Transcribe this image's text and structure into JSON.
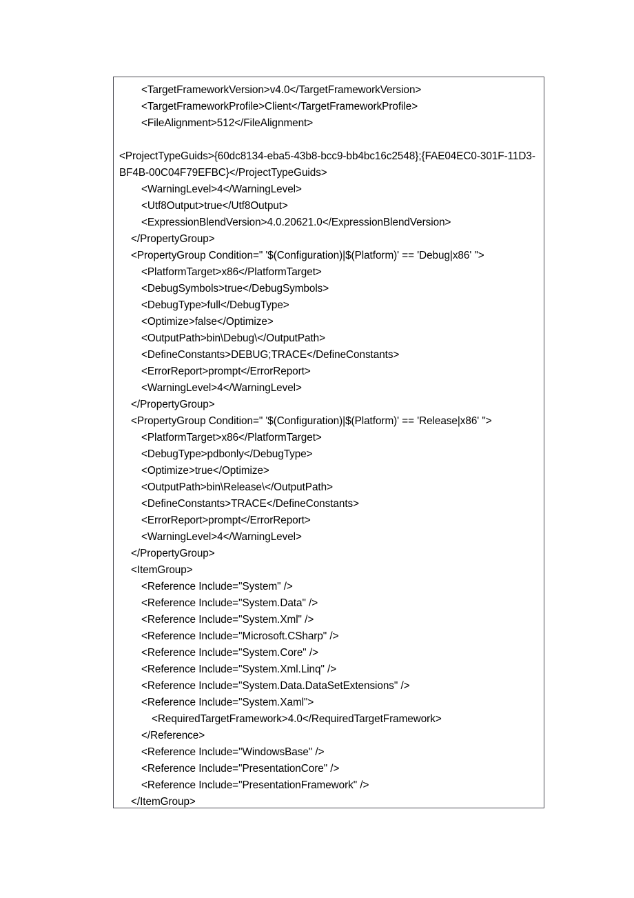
{
  "document": {
    "type": "xml-code-listing",
    "language": "MSBuild XML project file",
    "frame": {
      "border_color": "#4a4a52",
      "background_color": "#ffffff",
      "text_color": "#000000"
    },
    "lines": [
      {
        "id": "line-1",
        "indent": 2,
        "text": "<TargetFrameworkVersion>v4.0</TargetFrameworkVersion>"
      },
      {
        "id": "line-2",
        "indent": 2,
        "text": "<TargetFrameworkProfile>Client</TargetFrameworkProfile>"
      },
      {
        "id": "line-3",
        "indent": 2,
        "text": "<FileAlignment>512</FileAlignment>"
      },
      {
        "id": "line-4",
        "indent": 0,
        "text": "",
        "blank": true
      },
      {
        "id": "line-5",
        "indent": 0,
        "wrap": true,
        "text": "<ProjectTypeGuids>{60dc8134-eba5-43b8-bcc9-bb4bc16c2548};{FAE04EC0-301F-11D3-BF4B-00C04F79EFBC}</ProjectTypeGuids>"
      },
      {
        "id": "line-6",
        "indent": 2,
        "text": "<WarningLevel>4</WarningLevel>"
      },
      {
        "id": "line-7",
        "indent": 2,
        "text": "<Utf8Output>true</Utf8Output>"
      },
      {
        "id": "line-8",
        "indent": 2,
        "text": "<ExpressionBlendVersion>4.0.20621.0</ExpressionBlendVersion>"
      },
      {
        "id": "line-9",
        "indent": 1,
        "text": "</PropertyGroup>"
      },
      {
        "id": "line-10",
        "indent": 1,
        "text": "<PropertyGroup Condition=\" '$(Configuration)|$(Platform)' == 'Debug|x86' \">"
      },
      {
        "id": "line-11",
        "indent": 2,
        "text": "<PlatformTarget>x86</PlatformTarget>"
      },
      {
        "id": "line-12",
        "indent": 2,
        "text": "<DebugSymbols>true</DebugSymbols>"
      },
      {
        "id": "line-13",
        "indent": 2,
        "text": "<DebugType>full</DebugType>"
      },
      {
        "id": "line-14",
        "indent": 2,
        "text": "<Optimize>false</Optimize>"
      },
      {
        "id": "line-15",
        "indent": 2,
        "text": "<OutputPath>bin\\Debug\\</OutputPath>"
      },
      {
        "id": "line-16",
        "indent": 2,
        "text": "<DefineConstants>DEBUG;TRACE</DefineConstants>"
      },
      {
        "id": "line-17",
        "indent": 2,
        "text": "<ErrorReport>prompt</ErrorReport>"
      },
      {
        "id": "line-18",
        "indent": 2,
        "text": "<WarningLevel>4</WarningLevel>"
      },
      {
        "id": "line-19",
        "indent": 1,
        "text": "</PropertyGroup>"
      },
      {
        "id": "line-20",
        "indent": 1,
        "text": "<PropertyGroup Condition=\" '$(Configuration)|$(Platform)' == 'Release|x86' \">"
      },
      {
        "id": "line-21",
        "indent": 2,
        "text": "<PlatformTarget>x86</PlatformTarget>"
      },
      {
        "id": "line-22",
        "indent": 2,
        "text": "<DebugType>pdbonly</DebugType>"
      },
      {
        "id": "line-23",
        "indent": 2,
        "text": "<Optimize>true</Optimize>"
      },
      {
        "id": "line-24",
        "indent": 2,
        "text": "<OutputPath>bin\\Release\\</OutputPath>"
      },
      {
        "id": "line-25",
        "indent": 2,
        "text": "<DefineConstants>TRACE</DefineConstants>"
      },
      {
        "id": "line-26",
        "indent": 2,
        "text": "<ErrorReport>prompt</ErrorReport>"
      },
      {
        "id": "line-27",
        "indent": 2,
        "text": "<WarningLevel>4</WarningLevel>"
      },
      {
        "id": "line-28",
        "indent": 1,
        "text": "</PropertyGroup>"
      },
      {
        "id": "line-29",
        "indent": 1,
        "text": "<ItemGroup>"
      },
      {
        "id": "line-30",
        "indent": 2,
        "text": "<Reference Include=\"System\" />"
      },
      {
        "id": "line-31",
        "indent": 2,
        "text": "<Reference Include=\"System.Data\" />"
      },
      {
        "id": "line-32",
        "indent": 2,
        "text": "<Reference Include=\"System.Xml\" />"
      },
      {
        "id": "line-33",
        "indent": 2,
        "text": "<Reference Include=\"Microsoft.CSharp\" />"
      },
      {
        "id": "line-34",
        "indent": 2,
        "text": "<Reference Include=\"System.Core\" />"
      },
      {
        "id": "line-35",
        "indent": 2,
        "text": "<Reference Include=\"System.Xml.Linq\" />"
      },
      {
        "id": "line-36",
        "indent": 2,
        "text": "<Reference Include=\"System.Data.DataSetExtensions\" />"
      },
      {
        "id": "line-37",
        "indent": 2,
        "text": "<Reference Include=\"System.Xaml\">"
      },
      {
        "id": "line-38",
        "indent": 3,
        "text": "<RequiredTargetFramework>4.0</RequiredTargetFramework>"
      },
      {
        "id": "line-39",
        "indent": 2,
        "text": "</Reference>"
      },
      {
        "id": "line-40",
        "indent": 2,
        "text": "<Reference Include=\"WindowsBase\" />"
      },
      {
        "id": "line-41",
        "indent": 2,
        "text": "<Reference Include=\"PresentationCore\" />"
      },
      {
        "id": "line-42",
        "indent": 2,
        "text": "<Reference Include=\"PresentationFramework\" />"
      },
      {
        "id": "line-43",
        "indent": 1,
        "text": "</ItemGroup>"
      }
    ]
  }
}
